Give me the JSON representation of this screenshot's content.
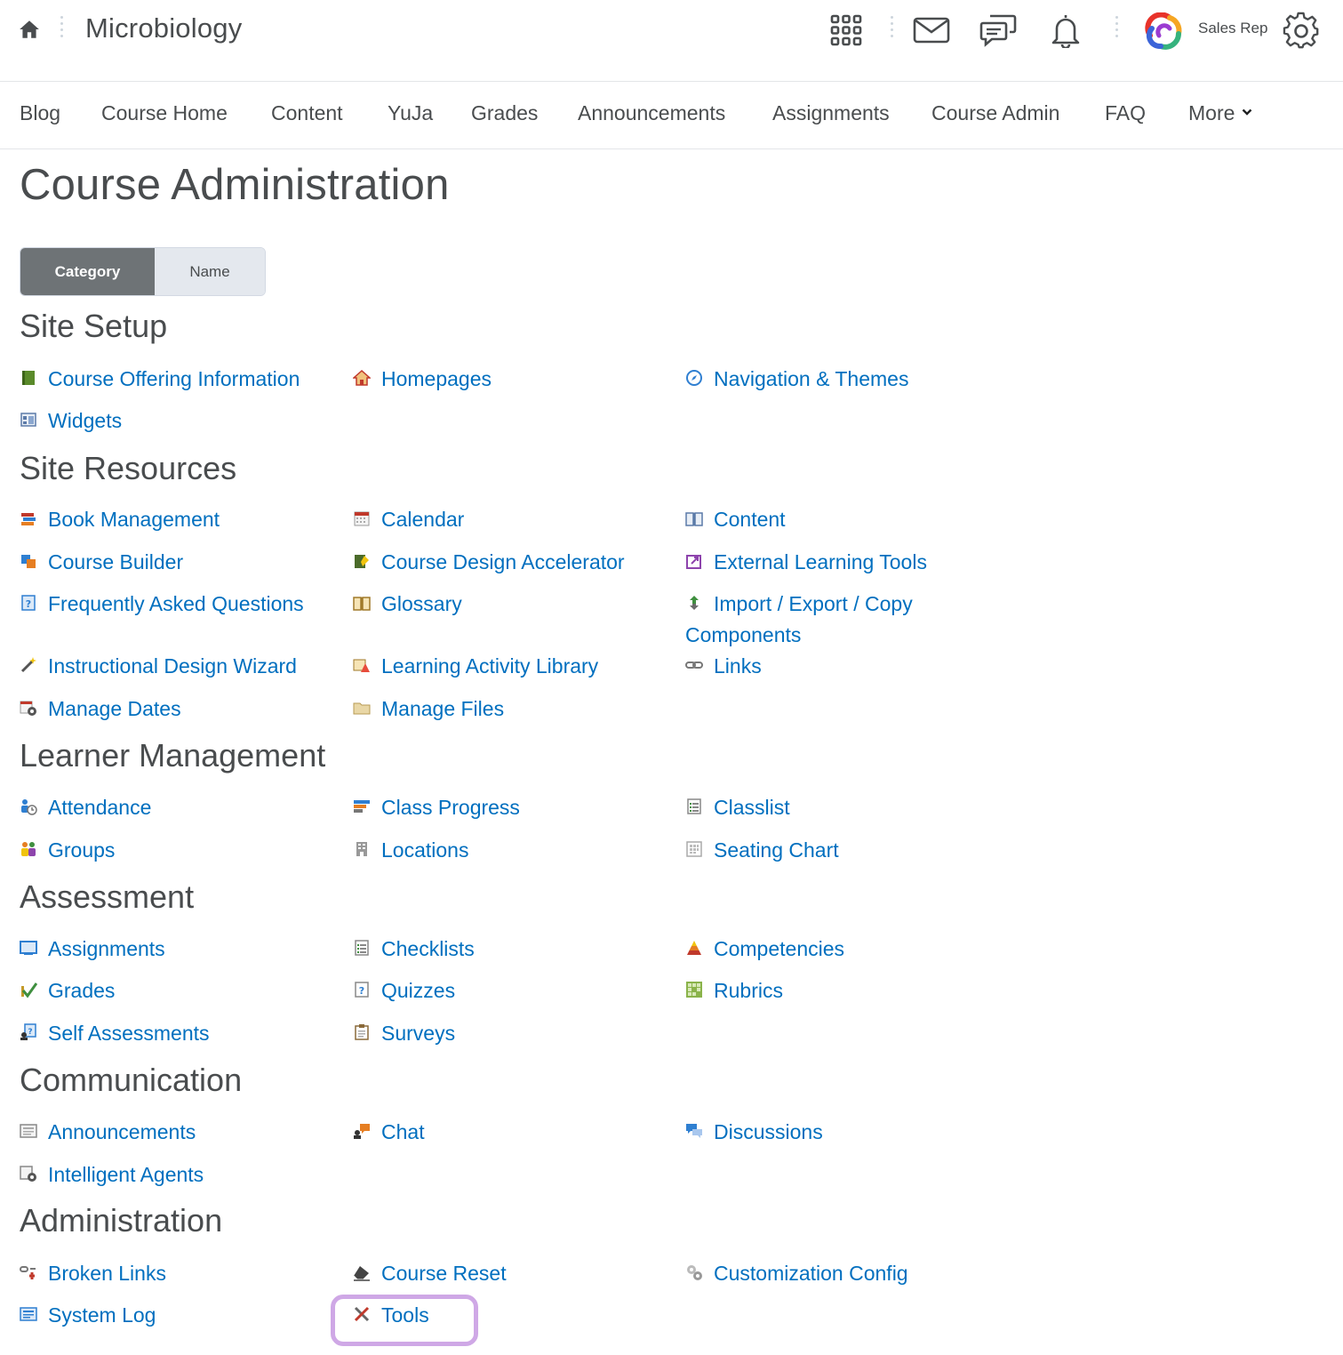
{
  "header": {
    "course_title": "Microbiology",
    "user_name": "Sales Rep",
    "icons": [
      "home-icon",
      "waffle-grid-icon",
      "mail-icon",
      "chat-bubbles-icon",
      "bell-icon",
      "brand-logo",
      "gear-icon"
    ]
  },
  "nav": {
    "items": [
      "Blog",
      "Course Home",
      "Content",
      "YuJa",
      "Grades",
      "Announcements",
      "Assignments",
      "Course Admin",
      "FAQ"
    ],
    "more_label": "More"
  },
  "page": {
    "title": "Course Administration",
    "toggle": {
      "category": "Category",
      "name": "Name"
    }
  },
  "sections": {
    "site_setup": {
      "title": "Site Setup",
      "tools": [
        "Course Offering Information",
        "Homepages",
        "Navigation & Themes",
        "Widgets"
      ]
    },
    "site_resources": {
      "title": "Site Resources",
      "tools": [
        "Book Management",
        "Calendar",
        "Content",
        "Course Builder",
        "Course Design Accelerator",
        "External Learning Tools",
        "Frequently Asked Questions",
        "Glossary",
        "Import / Export / Copy Components",
        "Instructional Design Wizard",
        "Learning Activity Library",
        "Links",
        "Manage Dates",
        "Manage Files"
      ]
    },
    "learner_management": {
      "title": "Learner Management",
      "tools": [
        "Attendance",
        "Class Progress",
        "Classlist",
        "Groups",
        "Locations",
        "Seating Chart"
      ]
    },
    "assessment": {
      "title": "Assessment",
      "tools": [
        "Assignments",
        "Checklists",
        "Competencies",
        "Grades",
        "Quizzes",
        "Rubrics",
        "Self Assessments",
        "Surveys"
      ]
    },
    "communication": {
      "title": "Communication",
      "tools": [
        "Announcements",
        "Chat",
        "Discussions",
        "Intelligent Agents"
      ]
    },
    "administration": {
      "title": "Administration",
      "tools": [
        "Broken Links",
        "Course Reset",
        "Customization Config",
        "System Log",
        "Tools"
      ]
    }
  },
  "colors": {
    "link": "#006fbf",
    "text": "#494c4e",
    "toggle_active": "#6e7376",
    "highlight": "#cfa8e6"
  }
}
